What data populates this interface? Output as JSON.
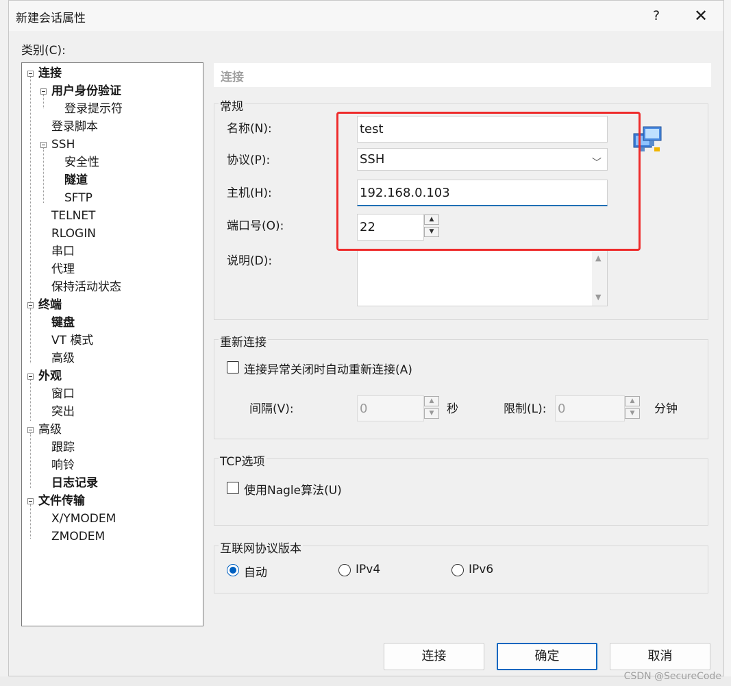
{
  "dialog": {
    "title": "新建会话属性",
    "help": "?",
    "close": "✕"
  },
  "category_label": "类别(C):",
  "tree": {
    "items": [
      {
        "label": "连接",
        "bold": true
      },
      {
        "label": "用户身份验证",
        "bold": true
      },
      {
        "label": "登录提示符",
        "bold": false
      },
      {
        "label": "登录脚本",
        "bold": false
      },
      {
        "label": "SSH",
        "bold": false
      },
      {
        "label": "安全性",
        "bold": false
      },
      {
        "label": "隧道",
        "bold": true
      },
      {
        "label": "SFTP",
        "bold": false
      },
      {
        "label": "TELNET",
        "bold": false
      },
      {
        "label": "RLOGIN",
        "bold": false
      },
      {
        "label": "串口",
        "bold": false
      },
      {
        "label": "代理",
        "bold": false
      },
      {
        "label": "保持活动状态",
        "bold": false
      },
      {
        "label": "终端",
        "bold": true
      },
      {
        "label": "键盘",
        "bold": true
      },
      {
        "label": "VT 模式",
        "bold": false
      },
      {
        "label": "高级",
        "bold": false
      },
      {
        "label": "外观",
        "bold": true
      },
      {
        "label": "窗口",
        "bold": false
      },
      {
        "label": "突出",
        "bold": false
      },
      {
        "label": "高级",
        "bold": false
      },
      {
        "label": "跟踪",
        "bold": false
      },
      {
        "label": "响铃",
        "bold": false
      },
      {
        "label": "日志记录",
        "bold": true
      },
      {
        "label": "文件传输",
        "bold": true
      },
      {
        "label": "X/YMODEM",
        "bold": false
      },
      {
        "label": "ZMODEM",
        "bold": false
      }
    ]
  },
  "section_header": "连接",
  "general": {
    "title": "常规",
    "name_label": "名称(N):",
    "name_value": "test",
    "protocol_label": "协议(P):",
    "protocol_value": "SSH",
    "host_label": "主机(H):",
    "host_value": "192.168.0.103",
    "port_label": "端口号(O):",
    "port_value": "22",
    "desc_label": "说明(D):",
    "desc_value": ""
  },
  "reconnect": {
    "title": "重新连接",
    "checkbox_label": "连接异常关闭时自动重新连接(A)",
    "checked": false,
    "interval_label": "间隔(V):",
    "interval_value": "0",
    "interval_unit": "秒",
    "limit_label": "限制(L):",
    "limit_value": "0",
    "limit_unit": "分钟"
  },
  "tcp": {
    "title": "TCP选项",
    "nagle_label": "使用Nagle算法(U)",
    "checked": false
  },
  "ip_version": {
    "title": "互联网协议版本",
    "options": [
      "自动",
      "IPv4",
      "IPv6"
    ],
    "selected": "自动"
  },
  "buttons": {
    "connect": "连接",
    "ok": "确定",
    "cancel": "取消"
  },
  "watermark": "CSDN @SecureCode",
  "colors": {
    "accent": "#0067c0",
    "highlight_box": "#ee2b2b"
  }
}
